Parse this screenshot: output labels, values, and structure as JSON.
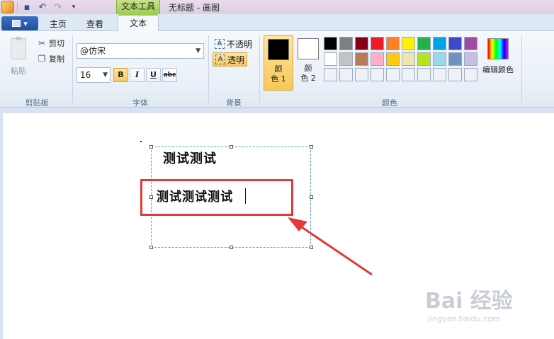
{
  "titlebar": {
    "context_tab": "文本工具",
    "title": "无标题 - 画图",
    "qat_icons": [
      "app-icon",
      "save-icon",
      "undo-icon",
      "redo-icon",
      "customize-icon"
    ]
  },
  "tabs": {
    "file_menu": "▾",
    "home": "主页",
    "view": "查看",
    "text": "文本"
  },
  "clipboard": {
    "paste": "粘贴",
    "cut": "剪切",
    "copy": "复制",
    "group": "剪贴板"
  },
  "font": {
    "family_value": "@仿宋",
    "size_value": "16",
    "bold": "B",
    "italic": "I",
    "underline": "U",
    "strikethrough": "abc",
    "group": "字体"
  },
  "background": {
    "opaque": "不透明",
    "transparent": "透明",
    "group": "背景"
  },
  "colors": {
    "color1_top": "颜",
    "color1_bottom": "色 1",
    "color2_top": "颜",
    "color2_bottom": "色 2",
    "color1_value": "#000000",
    "color2_value": "#ffffff",
    "palette_row1": [
      "#000000",
      "#7f7f7f",
      "#880015",
      "#ed1c24",
      "#ff7f27",
      "#fff200",
      "#22b14c",
      "#00a2e8",
      "#3f48cc",
      "#a349a4"
    ],
    "palette_row2": [
      "#ffffff",
      "#c3c3c3",
      "#b97a57",
      "#ffaec9",
      "#ffc90e",
      "#efe4b0",
      "#b5e61d",
      "#99d9ea",
      "#7092be",
      "#c8bfe7"
    ],
    "edit": "编辑颜色",
    "group": "颜色"
  },
  "canvas": {
    "line1": "测试测试",
    "line2": "测试测试测试"
  },
  "watermark": {
    "main": "Bai 经验",
    "sub": "jingyan.baidu.com"
  }
}
